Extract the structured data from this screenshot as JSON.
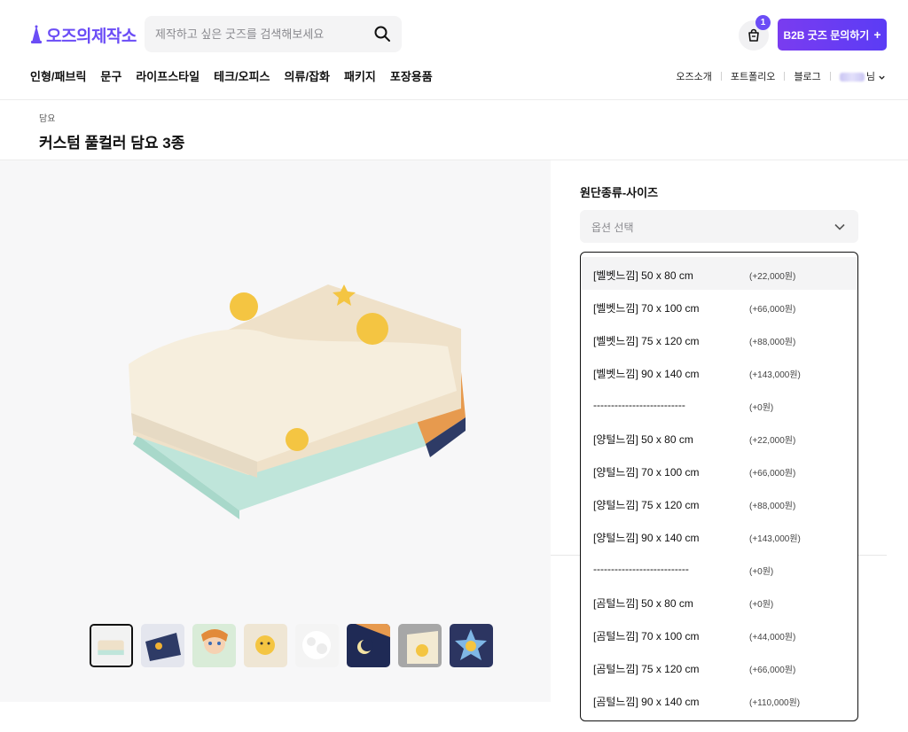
{
  "brand": {
    "logo_text": "오즈의제작소",
    "accent": "#6b4df6"
  },
  "search": {
    "placeholder": "제작하고 싶은 굿즈를 검색해보세요"
  },
  "cart": {
    "badge_count": "1"
  },
  "b2b": {
    "label": "B2B 굿즈 문의하기",
    "plus": "+"
  },
  "nav": {
    "items": [
      "인형/패브릭",
      "문구",
      "라이프스타일",
      "테크/오피스",
      "의류/잡화",
      "패키지",
      "포장용품"
    ]
  },
  "util": {
    "items": [
      "오즈소개",
      "포트폴리오",
      "블로그"
    ],
    "user_suffix": "님"
  },
  "product": {
    "breadcrumb": "담요",
    "title": "커스텀 풀컬러 담요 3종"
  },
  "option": {
    "label": "원단종류-사이즈",
    "placeholder": "옵션 선택",
    "items": [
      {
        "name": "[벨벳느낌] 50 x 80 cm",
        "price": "(+22,000원)"
      },
      {
        "name": "[벨벳느낌] 70 x 100 cm",
        "price": "(+66,000원)"
      },
      {
        "name": "[벨벳느낌] 75 x 120 cm",
        "price": "(+88,000원)"
      },
      {
        "name": "[벨벳느낌] 90 x 140 cm",
        "price": "(+143,000원)"
      },
      {
        "name": "--------------------------",
        "price": "(+0원)"
      },
      {
        "name": "[양털느낌] 50 x 80 cm",
        "price": "(+22,000원)"
      },
      {
        "name": "[양털느낌] 70 x 100 cm",
        "price": "(+66,000원)"
      },
      {
        "name": "[양털느낌] 75 x 120 cm",
        "price": "(+88,000원)"
      },
      {
        "name": "[양털느낌] 90 x 140 cm",
        "price": "(+143,000원)"
      },
      {
        "name": "---------------------------",
        "price": "(+0원)"
      },
      {
        "name": "[곰털느낌] 50 x 80 cm",
        "price": "(+0원)"
      },
      {
        "name": "[곰털느낌] 70 x 100 cm",
        "price": "(+44,000원)"
      },
      {
        "name": "[곰털느낌] 75 x 120 cm",
        "price": "(+66,000원)"
      },
      {
        "name": "[곰털느낌] 90 x 140 cm",
        "price": "(+110,000원)"
      }
    ]
  }
}
